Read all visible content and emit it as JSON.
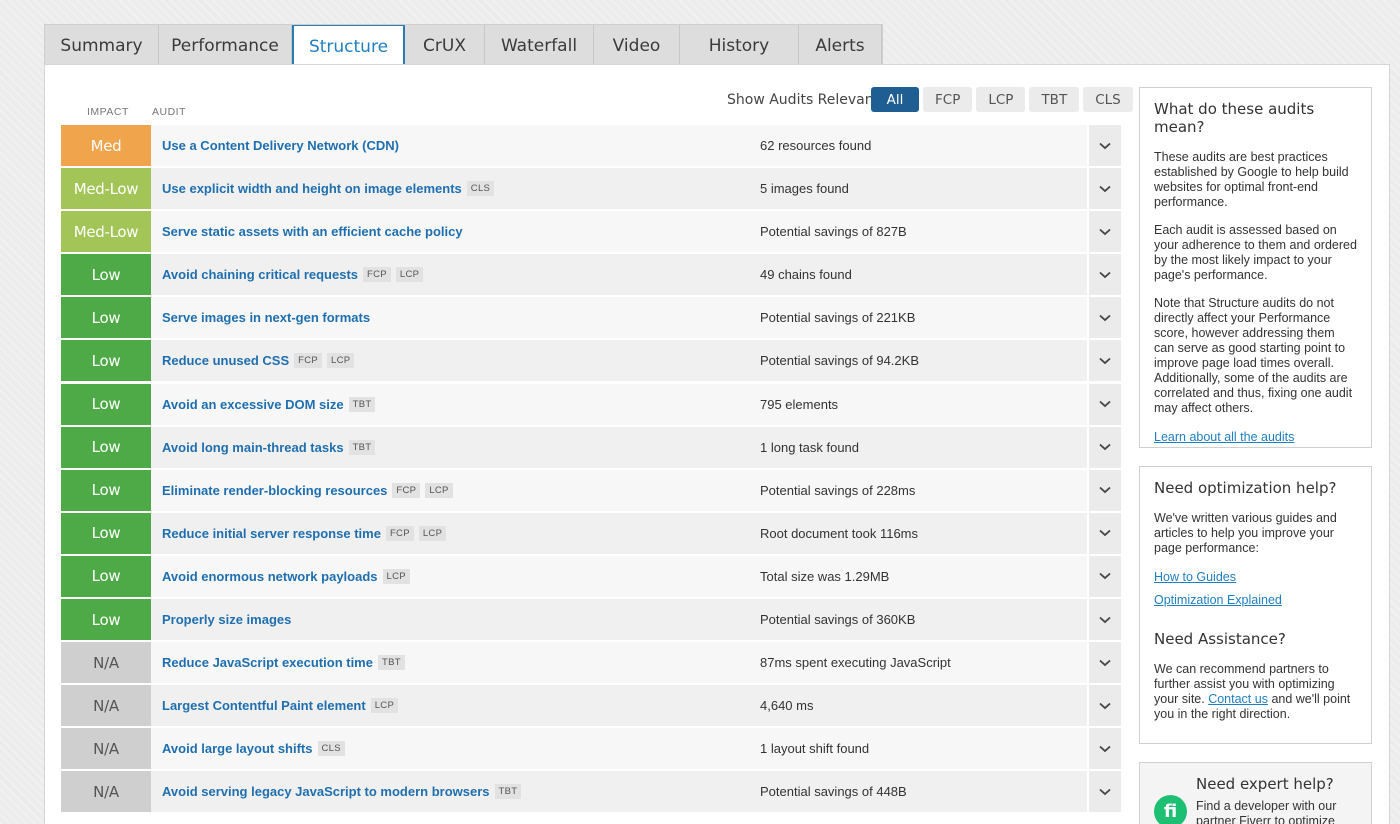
{
  "tabs": [
    "Summary",
    "Performance",
    "Structure",
    "CrUX",
    "Waterfall",
    "Video",
    "History",
    "Alerts"
  ],
  "active_tab": "Structure",
  "columns": {
    "impact": "IMPACT",
    "audit": "AUDIT"
  },
  "filter": {
    "label": "Show Audits Relevant to",
    "options": [
      "All",
      "FCP",
      "LCP",
      "TBT",
      "CLS"
    ],
    "selected": "All"
  },
  "impact_colors": {
    "Med": "#f0a44b",
    "Med-Low": "#a3c456",
    "Low": "#4eaa47",
    "N/A": "#cfcfcf"
  },
  "audits": [
    {
      "impact": "Med",
      "title": "Use a Content Delivery Network (CDN)",
      "tags": [],
      "finding": "62 resources found"
    },
    {
      "impact": "Med-Low",
      "title": "Use explicit width and height on image elements",
      "tags": [
        "CLS"
      ],
      "finding": "5 images found"
    },
    {
      "impact": "Med-Low",
      "title": "Serve static assets with an efficient cache policy",
      "tags": [],
      "finding": "Potential savings of 827B"
    },
    {
      "impact": "Low",
      "title": "Avoid chaining critical requests",
      "tags": [
        "FCP",
        "LCP"
      ],
      "finding": "49 chains found"
    },
    {
      "impact": "Low",
      "title": "Serve images in next-gen formats",
      "tags": [],
      "finding": "Potential savings of 221KB"
    },
    {
      "impact": "Low",
      "title": "Reduce unused CSS",
      "tags": [
        "FCP",
        "LCP"
      ],
      "finding": "Potential savings of 94.2KB"
    },
    {
      "impact": "Low",
      "title": "Avoid an excessive DOM size",
      "tags": [
        "TBT"
      ],
      "finding": "795 elements"
    },
    {
      "impact": "Low",
      "title": "Avoid long main-thread tasks",
      "tags": [
        "TBT"
      ],
      "finding": "1 long task found"
    },
    {
      "impact": "Low",
      "title": "Eliminate render-blocking resources",
      "tags": [
        "FCP",
        "LCP"
      ],
      "finding": "Potential savings of 228ms"
    },
    {
      "impact": "Low",
      "title": "Reduce initial server response time",
      "tags": [
        "FCP",
        "LCP"
      ],
      "finding": "Root document took 116ms"
    },
    {
      "impact": "Low",
      "title": "Avoid enormous network payloads",
      "tags": [
        "LCP"
      ],
      "finding": "Total size was 1.29MB"
    },
    {
      "impact": "Low",
      "title": "Properly size images",
      "tags": [],
      "finding": "Potential savings of 360KB"
    },
    {
      "impact": "N/A",
      "title": "Reduce JavaScript execution time",
      "tags": [
        "TBT"
      ],
      "finding": "87ms spent executing JavaScript"
    },
    {
      "impact": "N/A",
      "title": "Largest Contentful Paint element",
      "tags": [
        "LCP"
      ],
      "finding": "4,640 ms"
    },
    {
      "impact": "N/A",
      "title": "Avoid large layout shifts",
      "tags": [
        "CLS"
      ],
      "finding": "1 layout shift found"
    },
    {
      "impact": "N/A",
      "title": "Avoid serving legacy JavaScript to modern browsers",
      "tags": [
        "TBT"
      ],
      "finding": "Potential savings of 448B"
    }
  ],
  "sidebar": {
    "about": {
      "title": "What do these audits mean?",
      "p1": "These audits are best practices established by Google to help build websites for optimal front-end performance.",
      "p2": "Each audit is assessed based on your adherence to them and ordered by the most likely impact to your page's performance.",
      "p3": "Note that Structure audits do not directly affect your Performance score, however addressing them can serve as good starting point to improve page load times overall. Additionally, some of the audits are correlated and thus, fixing one audit may affect others.",
      "link": "Learn about all the audits"
    },
    "help": {
      "title": "Need optimization help?",
      "text": "We've written various guides and articles to help you improve your page performance:",
      "link1": "How to Guides",
      "link2": "Optimization Explained"
    },
    "assist": {
      "title": "Need Assistance?",
      "text_before": "We can recommend partners to further assist you with optimizing your site.",
      "link": "Contact us",
      "text_after": "and we'll point you in the right direction."
    },
    "expert": {
      "title": "Need expert help?",
      "text": "Find a developer with our partner Fiverr to optimize",
      "logo": "fi"
    }
  }
}
